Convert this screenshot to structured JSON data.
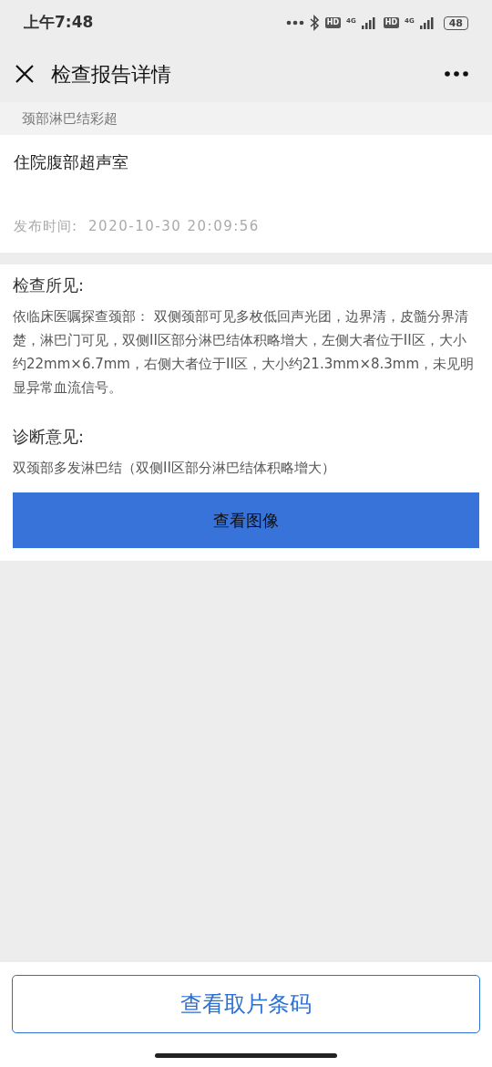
{
  "status_bar": {
    "time": "上午7:48",
    "hd_labels": [
      "HD",
      "HD"
    ],
    "network_labels": [
      "4G",
      "4G"
    ],
    "battery": "48"
  },
  "header": {
    "title": "检查报告详情"
  },
  "exam_name": "颈部淋巴结彩超",
  "report": {
    "department": "住院腹部超声室",
    "publish_label": "发布时间:",
    "publish_time": "2020-10-30 20:09:56"
  },
  "findings": {
    "heading": "检查所见:",
    "text": "依临床医嘱探查颈部： 双侧颈部可见多枚低回声光团，边界清，皮髓分界清楚，淋巴门可见，双侧II区部分淋巴结体积略增大，左侧大者位于II区，大小约22mm×6.7mm，右侧大者位于II区，大小约21.3mm×8.3mm，未见明显异常血流信号。"
  },
  "diagnosis": {
    "heading": "诊断意见:",
    "text": "双颈部多发淋巴结（双侧II区部分淋巴结体积略增大）"
  },
  "view_images_button": "查看图像",
  "barcode_button": "查看取片条码"
}
